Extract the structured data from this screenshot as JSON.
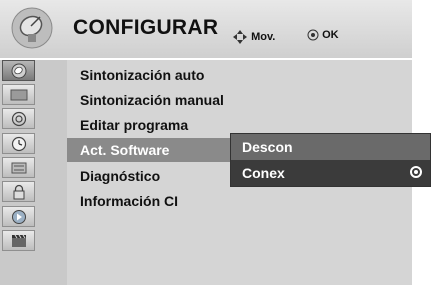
{
  "header": {
    "icon": "satellite-dish-icon",
    "title": "CONFIGURAR",
    "hint_move": "Mov.",
    "hint_ok": "OK"
  },
  "sidebar": {
    "items": [
      {
        "icon": "satellite-dish-icon",
        "active": true
      },
      {
        "icon": "picture-icon",
        "active": false
      },
      {
        "icon": "audio-icon",
        "active": false
      },
      {
        "icon": "clock-icon",
        "active": false
      },
      {
        "icon": "option-icon",
        "active": false
      },
      {
        "icon": "lock-icon",
        "active": false
      },
      {
        "icon": "input-icon",
        "active": false
      },
      {
        "icon": "usb-icon",
        "active": false
      }
    ]
  },
  "menu": {
    "items": [
      {
        "label": "Sintonización auto"
      },
      {
        "label": "Sintonización manual"
      },
      {
        "label": "Editar programa"
      },
      {
        "label": "Act. Software",
        "selected": true
      },
      {
        "label": "Diagnóstico"
      },
      {
        "label": "Información CI"
      }
    ]
  },
  "submenu": {
    "options": [
      {
        "label": "Descon",
        "checked": false
      },
      {
        "label": "Conex",
        "checked": true
      }
    ]
  },
  "colors": {
    "panel": "#d5d5d5",
    "selected_row": "#8a8a8a",
    "submenu_bg": "#5e5e5e"
  }
}
